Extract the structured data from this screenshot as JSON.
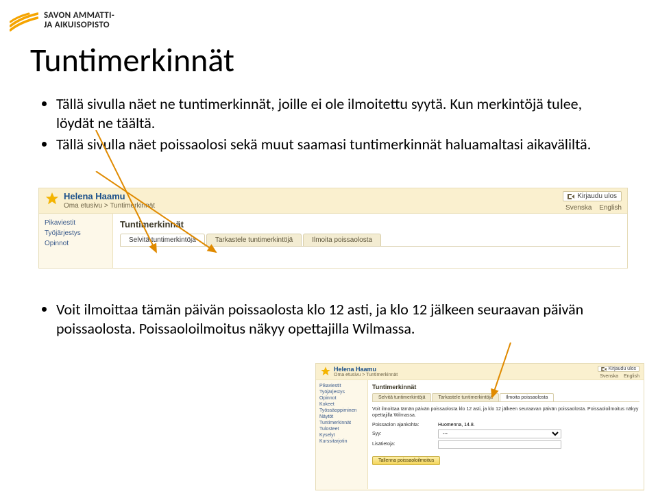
{
  "logo": {
    "line1": "SAVON AMMATTI-",
    "line2": "JA AIKUISOPISTO"
  },
  "title": "Tuntimerkinnät",
  "bullets_top": [
    "Tällä sivulla näet ne tuntimerkinnät, joille ei ole ilmoitettu syytä. Kun merkintöjä tulee, löydät ne täältä.",
    "Tällä sivulla näet poissaolosi sekä muut saamasi tuntimerkinnät haluamaltasi aikaväliltä."
  ],
  "bullets_bottom": [
    "Voit ilmoittaa tämän päivän poissaolosta klo 12 asti, ja klo 12 jälkeen seuraavan päivän poissaolosta. Poissaoloilmoitus näkyy opettajilla Wilmassa."
  ],
  "shot1": {
    "user": "Helena Haamu",
    "crumb_home": "Oma etusivu",
    "crumb_page": "Tuntimerkinnät",
    "logout": "Kirjaudu ulos",
    "lang_sv": "Svenska",
    "lang_en": "English",
    "page_h": "Tuntimerkinnät",
    "side": [
      "Pikaviestit",
      "Työjärjestys",
      "Opinnot"
    ],
    "tabs": [
      "Selvitä tuntimerkintöjä",
      "Tarkastele tuntimerkintöjä",
      "Ilmoita poissaolosta"
    ]
  },
  "shot2": {
    "user": "Helena Haamu",
    "crumb_home": "Oma etusivu",
    "crumb_page": "Tuntimerkinnät",
    "logout": "Kirjaudu ulos",
    "lang_sv": "Svenska",
    "lang_en": "English",
    "page_h": "Tuntimerkinnät",
    "side": [
      "Pikaviestit",
      "Työjärjestys",
      "Opinnot",
      "Kokeet",
      "Työssäoppiminen",
      "Näytöt",
      "Tuntimerkinnät",
      "Tulosteet",
      "Kyselyt",
      "Kurssitarjotin"
    ],
    "tabs": [
      "Selvitä tuntimerkintöjä",
      "Tarkastele tuntimerkintöjä",
      "Ilmoita poissaolosta"
    ],
    "desc": "Voit ilmoittaa tämän päivän poissaolosta klo 12 asti, ja klo 12 jälkeen seuraavan päivän poissaolosta. Poissaoloilmoitus näkyy opettajilla Wilmassa.",
    "label_time": "Poissaolon ajankohta:",
    "value_time": "Huomenna, 14.8.",
    "label_reason": "Syy:",
    "reason_placeholder": "---",
    "label_info": "Lisätietoja:",
    "submit": "Tallenna poissaoloilmoitus"
  }
}
